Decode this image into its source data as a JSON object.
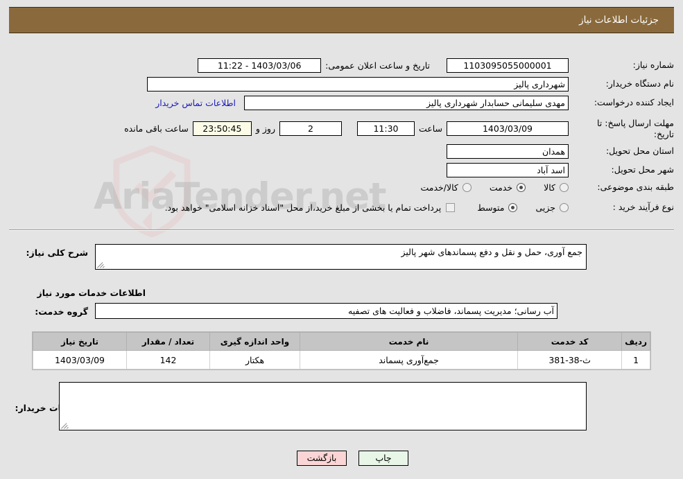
{
  "header": {
    "title": "جزئیات اطلاعات نیاز"
  },
  "watermark": {
    "text": "AriaTender.net"
  },
  "form": {
    "need_number_label": "شماره نیاز:",
    "need_number_value": "1103095055000001",
    "public_announce_label": "تاریخ و ساعت اعلان عمومی:",
    "public_announce_value": "11:22 - 1403/03/06",
    "buyer_org_label": "نام دستگاه خریدار:",
    "buyer_org_value": "شهرداری پالیز",
    "creator_label": "ایجاد کننده درخواست:",
    "creator_value": "مهدی سلیمانی حسابدار شهرداری پالیز",
    "contact_link": "اطلاعات تماس خریدار",
    "deadline_label": "مهلت ارسال پاسخ: تا تاریخ:",
    "deadline_date": "1403/03/09",
    "time_label": "ساعت",
    "deadline_time": "11:30",
    "days_value": "2",
    "days_label": "روز و",
    "countdown_value": "23:50:45",
    "countdown_label": "ساعت باقی مانده",
    "province_label": "استان محل تحویل:",
    "province_value": "همدان",
    "city_label": "شهر محل تحویل:",
    "city_value": "اسد آباد",
    "category_label": "طبقه بندی موضوعی:",
    "category_options": [
      {
        "label": "کالا",
        "selected": false
      },
      {
        "label": "خدمت",
        "selected": true
      },
      {
        "label": "کالا/خدمت",
        "selected": false
      }
    ],
    "process_label": "نوع فرآیند خرید :",
    "process_options": [
      {
        "label": "جزیی",
        "selected": false
      },
      {
        "label": "متوسط",
        "selected": true
      }
    ],
    "payment_checkbox_label": "پرداخت تمام یا بخشی از مبلغ خرید،از محل \"اسناد خزانه اسلامی\" خواهد بود.",
    "payment_checked": false
  },
  "need_summary": {
    "label": "شرح کلی نیاز:",
    "value": "جمع آوری، حمل و نقل و دفع پسماندهای شهر پالیز"
  },
  "services_section": {
    "heading": "اطلاعات خدمات مورد نیاز",
    "group_label": "گروه خدمت:",
    "group_value": "آب رسانی؛ مدیریت پسماند، فاضلاب و فعالیت های تصفیه"
  },
  "table": {
    "columns": [
      "ردیف",
      "کد خدمت",
      "نام خدمت",
      "واحد اندازه گیری",
      "تعداد / مقدار",
      "تاریخ نیاز"
    ],
    "rows": [
      {
        "row_no": "1",
        "service_code": "ث-38-381",
        "service_name": "جمع‌آوری پسماند",
        "unit": "هکتار",
        "quantity": "142",
        "need_date": "1403/03/09"
      }
    ]
  },
  "buyer_comments": {
    "label": "توضیحات خریدار:",
    "value": ""
  },
  "buttons": {
    "print": "چاپ",
    "back": "بازگشت"
  },
  "colors": {
    "header_bg": "#8a6a3c",
    "page_bg": "#e4e4e4",
    "link": "#1a1aba",
    "print_btn": "#e7f6e7",
    "back_btn": "#fbd5d5"
  }
}
